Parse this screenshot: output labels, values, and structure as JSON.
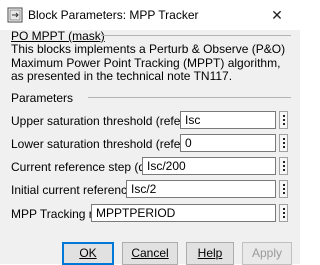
{
  "window": {
    "title": "Block Parameters: MPP Tracker"
  },
  "mask": {
    "heading": "PO MPPT (mask)",
    "description": "This blocks implements a Perturb & Observe (P&O) Maximum Power Point Tracking (MPPT) algorithm, as presented in the technical note TN117."
  },
  "parameters": {
    "heading": "Parameters",
    "fields": [
      {
        "label": "Upper saturation threshold (reference)",
        "value": "Isc"
      },
      {
        "label": "Lower saturation threshold (reference)",
        "value": "0"
      },
      {
        "label": "Current reference step (delta)",
        "value": "Isc/200"
      },
      {
        "label": "Initial current reference",
        "value": "Isc/2"
      },
      {
        "label": "MPP Tracking rate",
        "value": "MPPTPERIOD"
      }
    ]
  },
  "buttons": {
    "ok": "OK",
    "cancel": "Cancel",
    "help": "Help",
    "apply": "Apply"
  },
  "icons": {
    "app": "simulink-block-icon",
    "close": "close-icon",
    "menu": "vertical-ellipsis-icon"
  }
}
